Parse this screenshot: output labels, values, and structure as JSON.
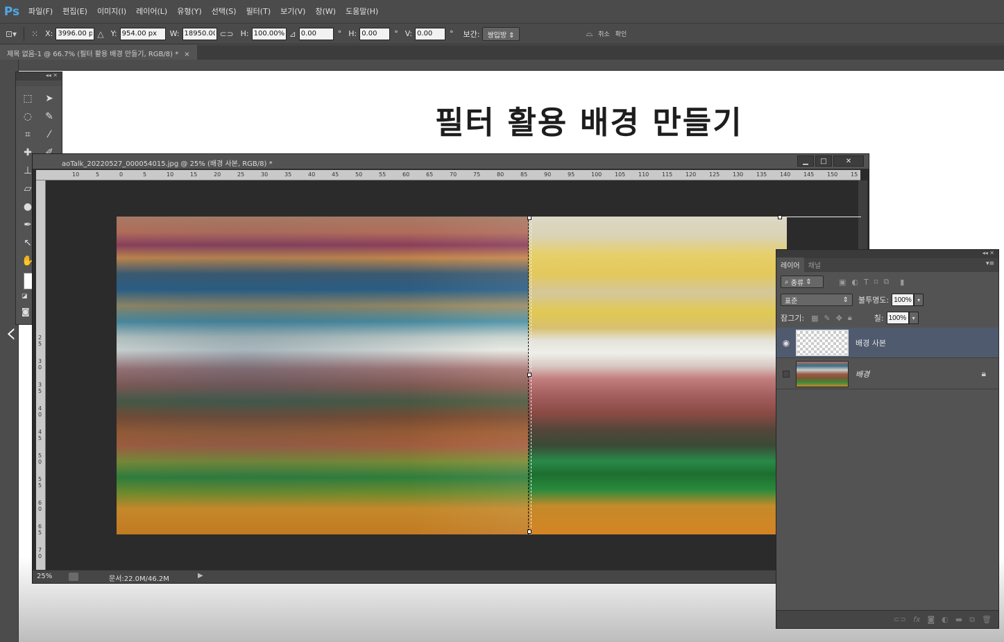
{
  "app": {
    "logo": "Ps"
  },
  "menu": [
    "파일(F)",
    "편집(E)",
    "이미지(I)",
    "레이어(L)",
    "유형(Y)",
    "선택(S)",
    "필터(T)",
    "보기(V)",
    "창(W)",
    "도움말(H)"
  ],
  "options": {
    "x_label": "X:",
    "x_value": "3996.00 px",
    "y_label": "Y:",
    "y_value": "954.00 px",
    "w_label": "W:",
    "w_value": "18950.00",
    "h_label": "H:",
    "h_value": "100.00%",
    "angle_value": "0.00",
    "hskew_label": "H:",
    "hskew_value": "0.00",
    "vskew_label": "V:",
    "vskew_value": "0.00",
    "degree": "°",
    "interp_label": "보간:",
    "interp_value": "쌍입방",
    "cancel_label": "취소",
    "commit_label": "확인"
  },
  "main_doc": {
    "tab_title": "제목 없음-1 @ 66.7% (필터 활용 배경 만들기, RGB/8) *",
    "close": "×"
  },
  "page": {
    "title": "필터 활용 배경 만들기"
  },
  "inner_doc": {
    "title": "aoTalk_20220527_000054015.jpg @ 25% (배경 사본, RGB/8) *",
    "minimize": "▁",
    "maximize": "□",
    "close": "✕",
    "ruler_top": [
      "10",
      "5",
      "0",
      "5",
      "10",
      "15",
      "20",
      "25",
      "30",
      "35",
      "40",
      "45",
      "50",
      "55",
      "60",
      "65",
      "70",
      "75",
      "80",
      "85",
      "90",
      "95",
      "100",
      "105",
      "110",
      "115",
      "120",
      "125",
      "130",
      "135",
      "140",
      "145",
      "150",
      "15"
    ],
    "ruler_left": [
      "2 5",
      "3 0",
      "3 5",
      "4 0",
      "4 5",
      "5 0",
      "5 5",
      "6 0",
      "6 5",
      "7 0"
    ],
    "zoom": "25%",
    "doc_info": "문서:22.0M/46.2M"
  },
  "layers": {
    "tabs": [
      "레이어",
      "채널"
    ],
    "filter_kind": "종류",
    "blend_mode": "표준",
    "opacity_label": "불투명도:",
    "opacity_value": "100%",
    "lock_label": "잠그기:",
    "fill_label": "칠:",
    "fill_value": "100%",
    "items": [
      {
        "name": "배경 사본",
        "visible": true,
        "selected": true
      },
      {
        "name": "배경",
        "visible": false,
        "locked": true
      }
    ]
  },
  "colors": {
    "accent_selected_layer": "#4f5a6e",
    "ps_logo": "#4fa8e8"
  }
}
